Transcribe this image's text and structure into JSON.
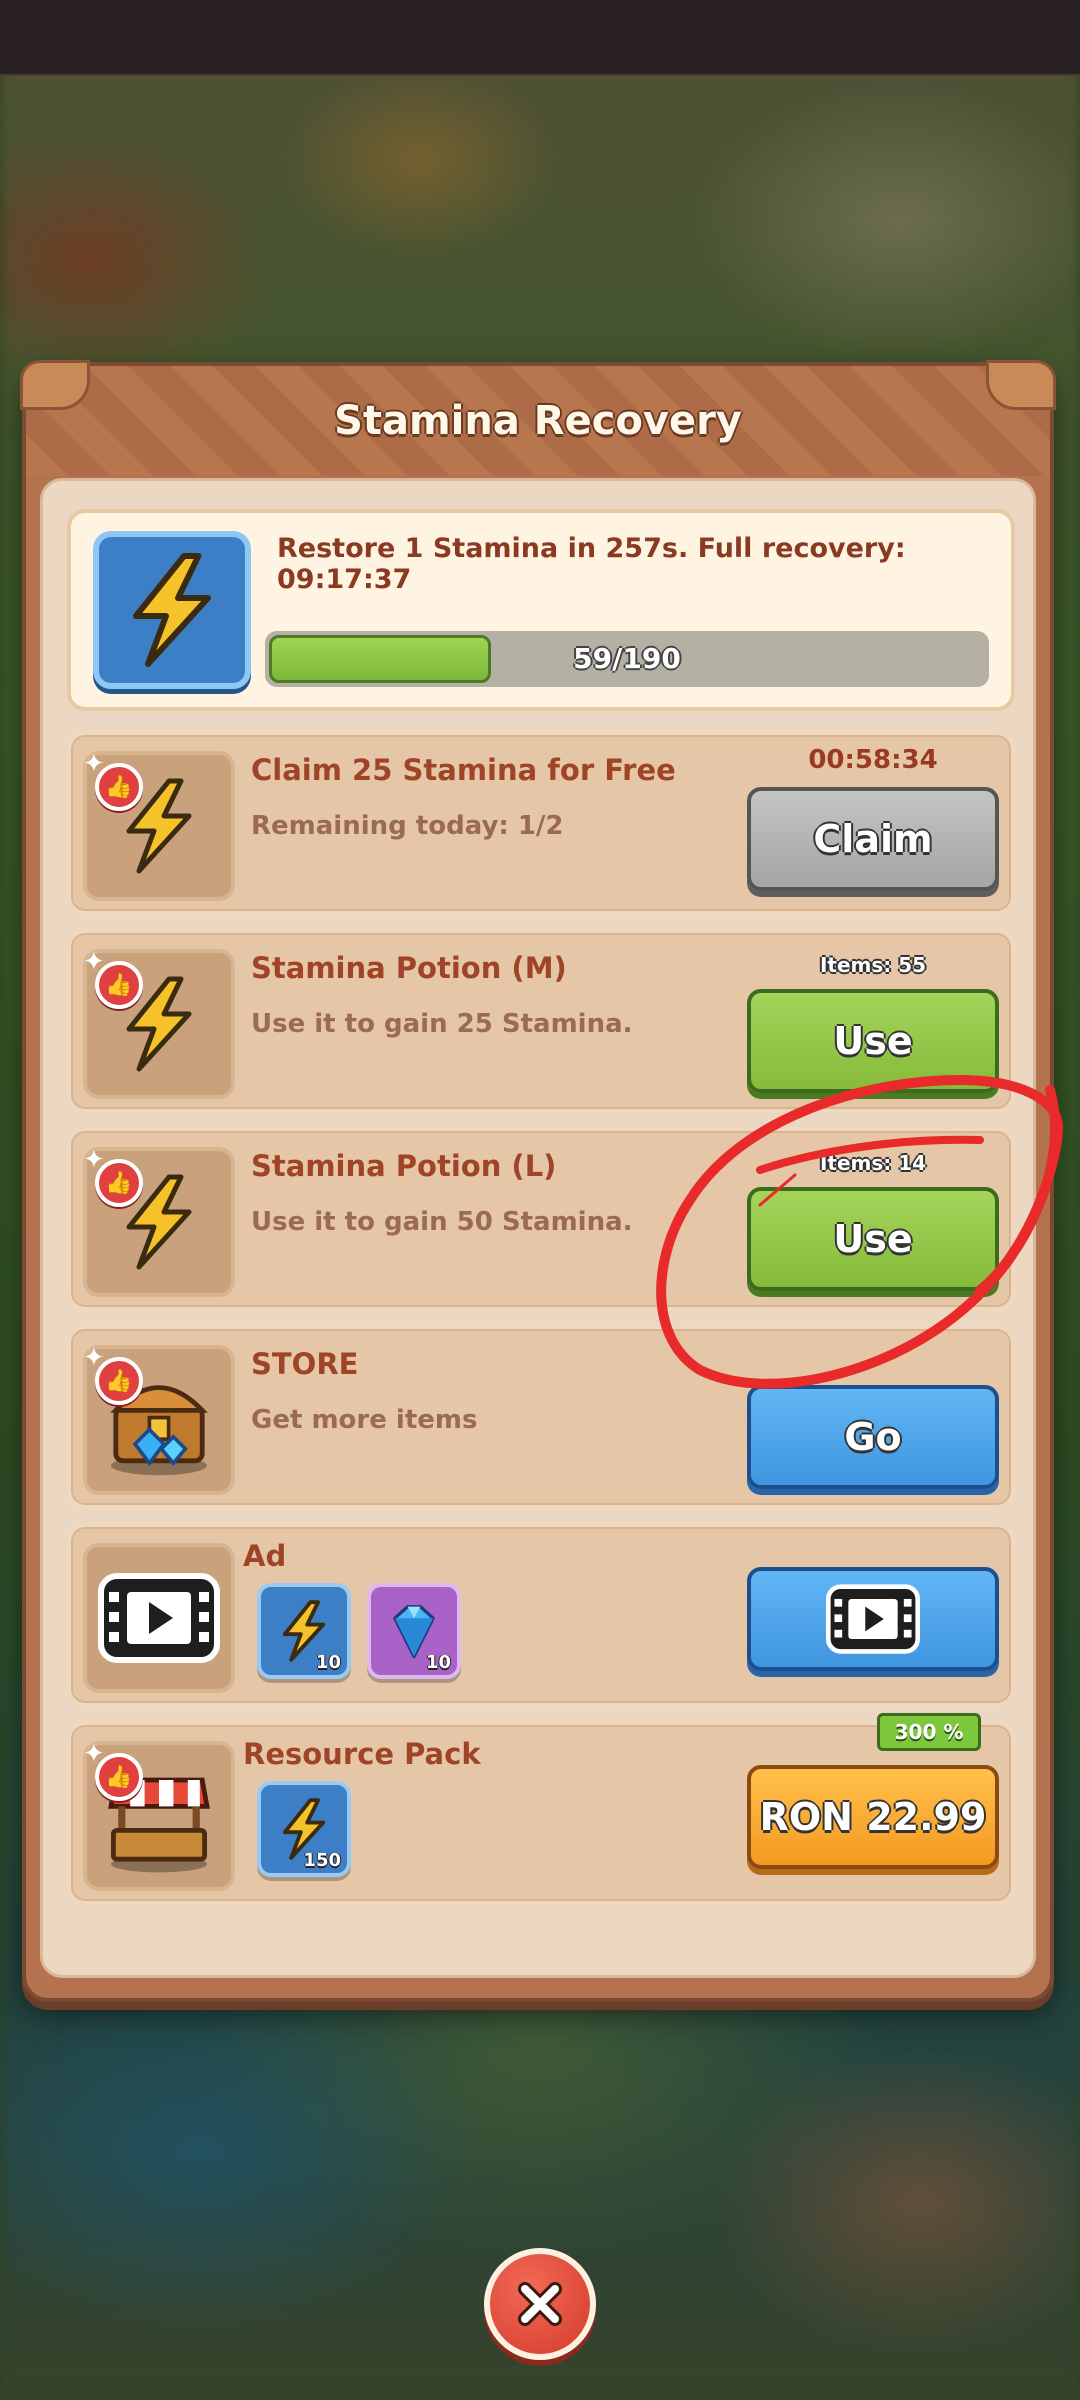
{
  "dialog": {
    "title": "Stamina Recovery"
  },
  "summary": {
    "icon": "lightning-bolt-icon",
    "recovery_text": "Restore 1 Stamina in 257s. Full recovery: 09:17:37",
    "progress_label": "59/190",
    "progress_fraction": 0.31
  },
  "rows": [
    {
      "icon": "lightning-bolt-icon",
      "title": "Claim 25 Stamina for Free",
      "subtitle": "Remaining today: 1/2",
      "timer": "00:58:34",
      "button_label": "Claim"
    },
    {
      "icon": "lightning-bolt-icon",
      "title": "Stamina Potion (M)",
      "subtitle": "Use it to gain 25 Stamina.",
      "items_label": "Items: 55",
      "button_label": "Use"
    },
    {
      "icon": "lightning-bolt-icon",
      "title": "Stamina Potion (L)",
      "subtitle": "Use it to gain 50 Stamina.",
      "items_label": "Items: 14",
      "button_label": "Use"
    },
    {
      "icon": "treasure-chest-icon",
      "title": "STORE",
      "subtitle": "Get more items",
      "button_label": "Go"
    },
    {
      "icon": "video-play-icon",
      "title": "Ad",
      "rewards": [
        {
          "icon": "lightning-bolt-icon",
          "count": "10"
        },
        {
          "icon": "diamond-gem-icon",
          "count": "10"
        }
      ],
      "button_icon": "video-play-icon"
    },
    {
      "icon": "market-stall-icon",
      "title": "Resource Pack",
      "rewards": [
        {
          "icon": "lightning-bolt-icon",
          "count": "150"
        }
      ],
      "bonus_label": "300 %",
      "button_label": "RON 22.99"
    }
  ],
  "close_icon": "close-x-icon",
  "colors": {
    "panel": "#b4724e",
    "inner": "#ecd8c2",
    "claim_gray": "#a5a5a5",
    "use_green": "#86bb3a",
    "go_blue": "#3f96e0",
    "price_orange": "#f49a22",
    "title_brown": "#a04428",
    "annotation_red": "#e82a2a"
  }
}
